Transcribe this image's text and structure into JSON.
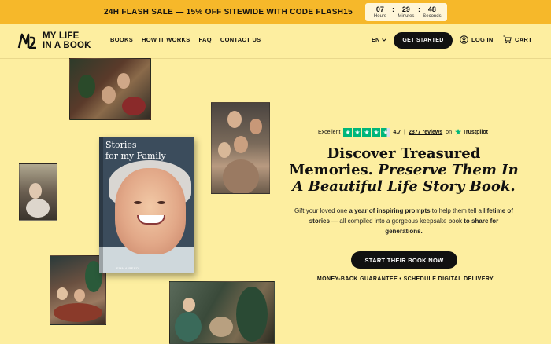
{
  "promo": {
    "text": "24H FLASH SALE — 15% OFF SITEWIDE WITH CODE FLASH15",
    "hours": "07",
    "minutes": "29",
    "seconds": "48",
    "hours_label": "Hours",
    "minutes_label": "Minutes",
    "seconds_label": "Seconds"
  },
  "header": {
    "logo_line1": "MY LIFE",
    "logo_line2": "IN A BOOK",
    "nav": [
      "BOOKS",
      "HOW IT WORKS",
      "FAQ",
      "CONTACT US"
    ],
    "language": "EN",
    "get_started": "GET STARTED",
    "login": "LOG IN",
    "cart": "CART"
  },
  "book": {
    "title_line1": "Stories",
    "title_line2": "for my Family",
    "author": "EMMA REED"
  },
  "rating": {
    "label": "Excellent",
    "score": "4.7",
    "reviews": "2877 reviews",
    "on": "on",
    "provider": "Trustpilot",
    "value": 4.7
  },
  "hero": {
    "headline_plain": "Discover Treasured Memories.",
    "headline_italic": "Preserve Them In A Beautiful Life Story Book.",
    "desc_1": "Gift your loved one ",
    "desc_bold_1": "a year of inspiring prompts",
    "desc_2": " to help them tell a ",
    "desc_bold_2": "lifetime of stories",
    "desc_3": " — all compiled into a gorgeous keepsake book ",
    "desc_bold_3": "to share for generations.",
    "cta": "START THEIR BOOK NOW",
    "guarantee": "MONEY-BACK GUARANTEE • SCHEDULE DIGITAL DELIVERY"
  },
  "colors": {
    "background": "#fdeea0",
    "promo_bar": "#f6b82a",
    "trustpilot_green": "#00b67a",
    "button": "#111111"
  }
}
